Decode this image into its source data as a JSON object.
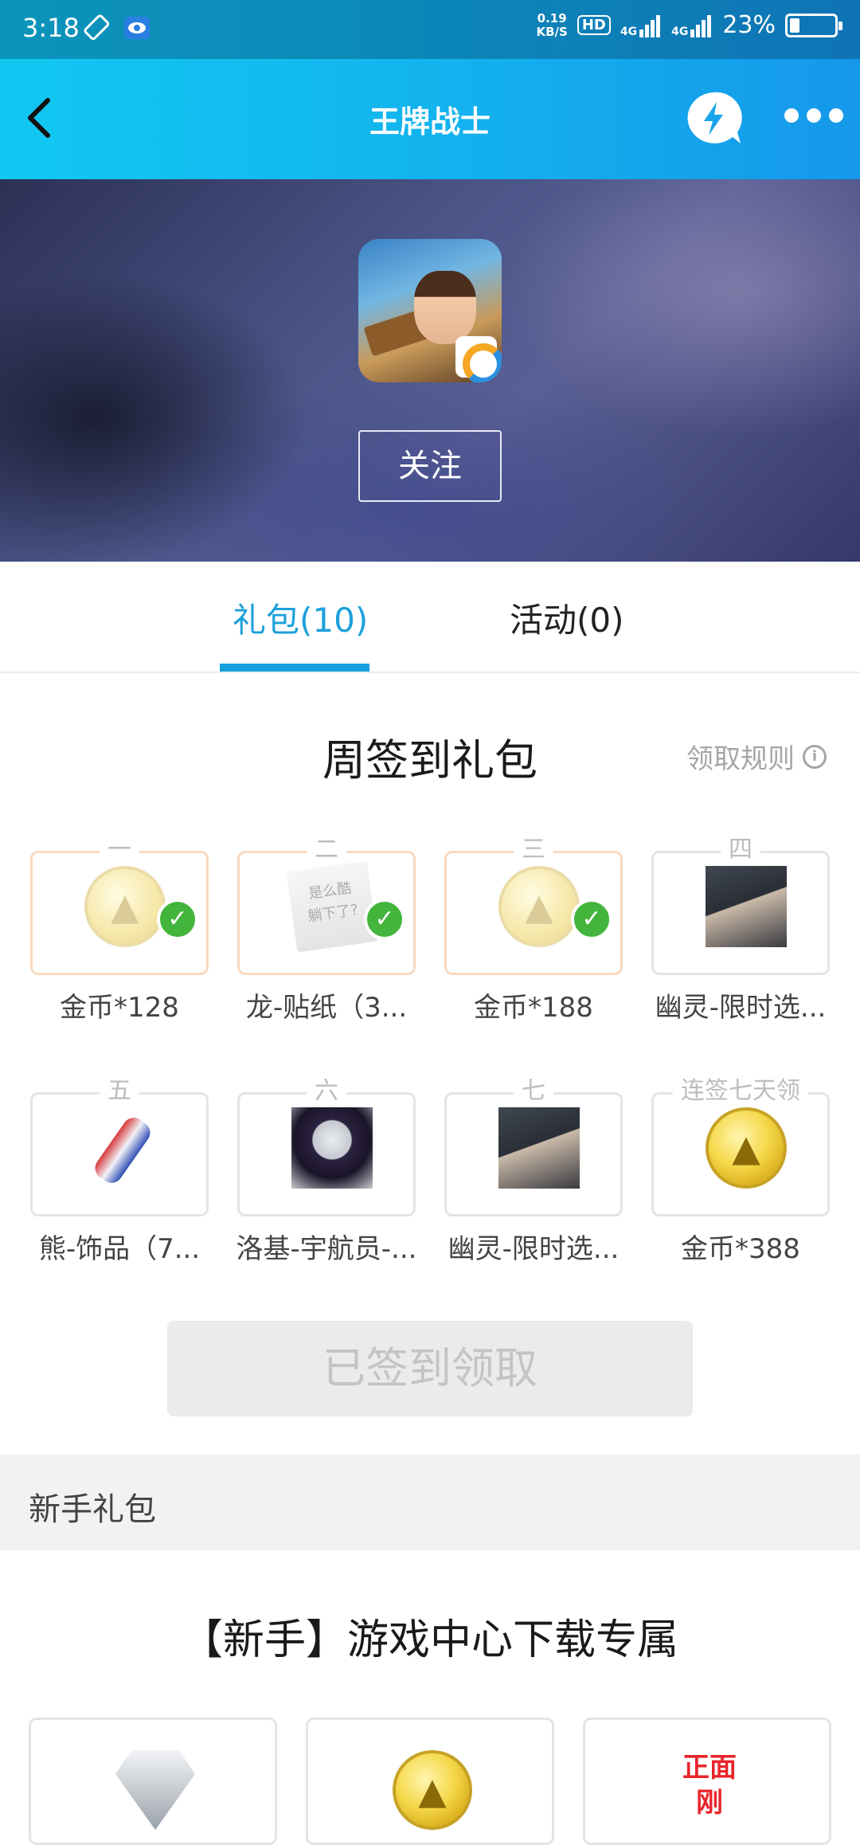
{
  "status_bar": {
    "time": "3:18",
    "net_speed_value": "0.19",
    "net_speed_unit": "KB/S",
    "hd_label": "HD",
    "network_1": "4G",
    "network_2": "4G",
    "battery_percent": "23%",
    "battery_level": 0.23
  },
  "header": {
    "title": "王牌战士",
    "icons": [
      "back-arrow-icon",
      "lightning-chat-icon",
      "more-icon"
    ]
  },
  "banner": {
    "follow_label": "关注"
  },
  "tabs": [
    {
      "label": "礼包(10)",
      "active": true
    },
    {
      "label": "活动(0)",
      "active": false
    }
  ],
  "weekly": {
    "title": "周签到礼包",
    "rules_label": "领取规则",
    "gifts": [
      {
        "day": "一",
        "name": "金币*128",
        "claimed": true,
        "icon": "coin-icon"
      },
      {
        "day": "二",
        "name": "龙-贴纸（3...",
        "claimed": true,
        "icon": "sticker-icon"
      },
      {
        "day": "三",
        "name": "金币*188",
        "claimed": true,
        "icon": "coin-icon"
      },
      {
        "day": "四",
        "name": "幽灵-限时选...",
        "claimed": false,
        "icon": "character-portrait-icon"
      },
      {
        "day": "五",
        "name": "熊-饰品（7...",
        "claimed": false,
        "icon": "bottle-icon"
      },
      {
        "day": "六",
        "name": "洛基-宇航员-...",
        "claimed": false,
        "icon": "astronaut-portrait-icon"
      },
      {
        "day": "七",
        "name": "幽灵-限时选...",
        "claimed": false,
        "icon": "character-portrait-icon"
      },
      {
        "day": "连签七天领",
        "name": "金币*388",
        "claimed": false,
        "icon": "coin-icon"
      }
    ],
    "sticker_text_1": "是么酷",
    "sticker_text_2": "躺下了?",
    "claim_button": "已签到领取"
  },
  "newbie": {
    "section_label": "新手礼包",
    "title": "【新手】游戏中心下载专属",
    "cards": [
      {
        "icon": "diamond-icon"
      },
      {
        "icon": "coin-icon"
      },
      {
        "icon": "badge-icon",
        "text": "正面刚"
      }
    ]
  },
  "colors": {
    "accent": "#16a0dd",
    "check_green": "#43b43c",
    "header_gradient_start": "#12c8f2",
    "header_gradient_end": "#1598ea"
  }
}
